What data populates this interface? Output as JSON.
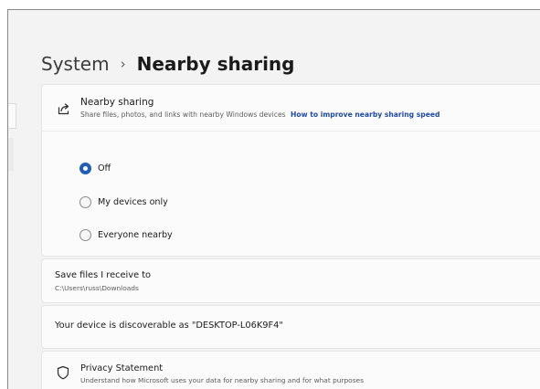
{
  "breadcrumb": {
    "parent": "System",
    "separator": "›",
    "current": "Nearby sharing"
  },
  "nearby_sharing": {
    "icon": "share-icon",
    "title": "Nearby sharing",
    "description": "Share files, photos, and links with nearby Windows devices",
    "link": "How to improve nearby sharing speed",
    "options": [
      {
        "label": "Off",
        "selected": true
      },
      {
        "label": "My devices only",
        "selected": false
      },
      {
        "label": "Everyone nearby",
        "selected": false
      }
    ]
  },
  "save_files": {
    "title": "Save files I receive to",
    "path": "C:\\Users\\russ\\Downloads"
  },
  "discoverable": {
    "text": "Your device is discoverable as \"DESKTOP-L06K9F4\""
  },
  "privacy": {
    "icon": "shield-icon",
    "title": "Privacy Statement",
    "description": "Understand how Microsoft uses your data for nearby sharing and for what purposes"
  },
  "colors": {
    "accent": "#1f5fb8",
    "link": "#1f4aa8",
    "background": "#f3f3f3",
    "card": "#fbfbfb"
  }
}
